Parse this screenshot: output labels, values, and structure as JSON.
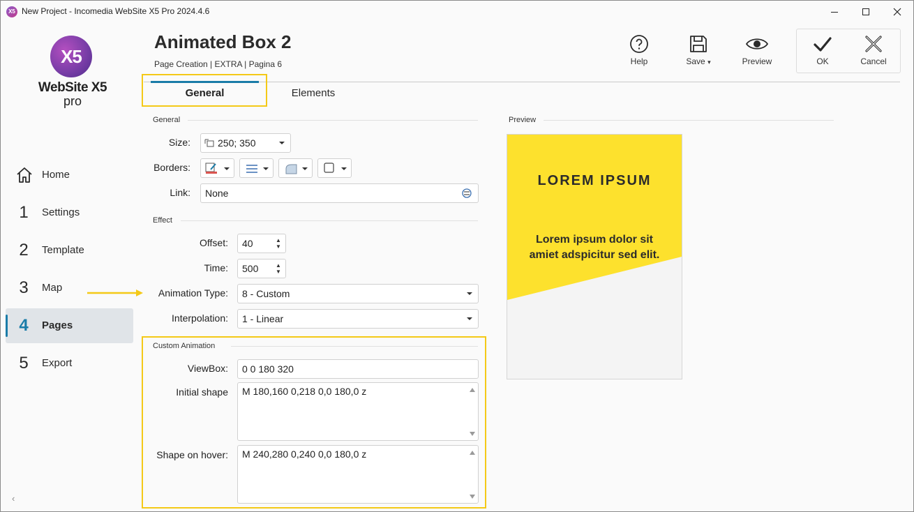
{
  "window": {
    "title": "New Project - Incomedia WebSite X5 Pro 2024.4.6",
    "app_icon": "X5"
  },
  "logo": {
    "mark": "X5",
    "name": "WebSite X5",
    "edition": "pro"
  },
  "nav": {
    "items": [
      {
        "num": "",
        "label": "Home",
        "icon": "home-icon"
      },
      {
        "num": "1",
        "label": "Settings"
      },
      {
        "num": "2",
        "label": "Template"
      },
      {
        "num": "3",
        "label": "Map"
      },
      {
        "num": "4",
        "label": "Pages",
        "active": true
      },
      {
        "num": "5",
        "label": "Export"
      }
    ],
    "collapse_icon": "‹"
  },
  "header": {
    "title": "Animated Box 2",
    "breadcrumb": "Page Creation | EXTRA | Pagina 6",
    "help": "Help",
    "save": "Save",
    "save_caret": "▾",
    "preview": "Preview",
    "ok": "OK",
    "cancel": "Cancel"
  },
  "tabs": {
    "general": "General",
    "elements": "Elements"
  },
  "general": {
    "section": "General",
    "size_label": "Size:",
    "size_value": "250; 350",
    "borders_label": "Borders:",
    "link_label": "Link:",
    "link_value": "None"
  },
  "effect": {
    "section": "Effect",
    "offset_label": "Offset:",
    "offset_value": "40",
    "time_label": "Time:",
    "time_value": "500",
    "animation_label": "Animation Type:",
    "animation_value": "8 - Custom",
    "interpolation_label": "Interpolation:",
    "interpolation_value": "1 - Linear"
  },
  "custom": {
    "section": "Custom Animation",
    "viewbox_label": "ViewBox:",
    "viewbox_value": "0 0 180 320",
    "initial_label": "Initial shape",
    "initial_value": "M 180,160 0,218 0,0 180,0 z",
    "hover_label": "Shape on hover:",
    "hover_value": "M 240,280 0,240 0,0 180,0 z"
  },
  "preview": {
    "section": "Preview",
    "title": "LOREM IPSUM",
    "text": "Lorem ipsum dolor sit amiet adspicitur sed elit.",
    "shape_color": "#fde12d"
  },
  "colors": {
    "accent": "#1a7ca8",
    "highlight": "#f4c917"
  }
}
